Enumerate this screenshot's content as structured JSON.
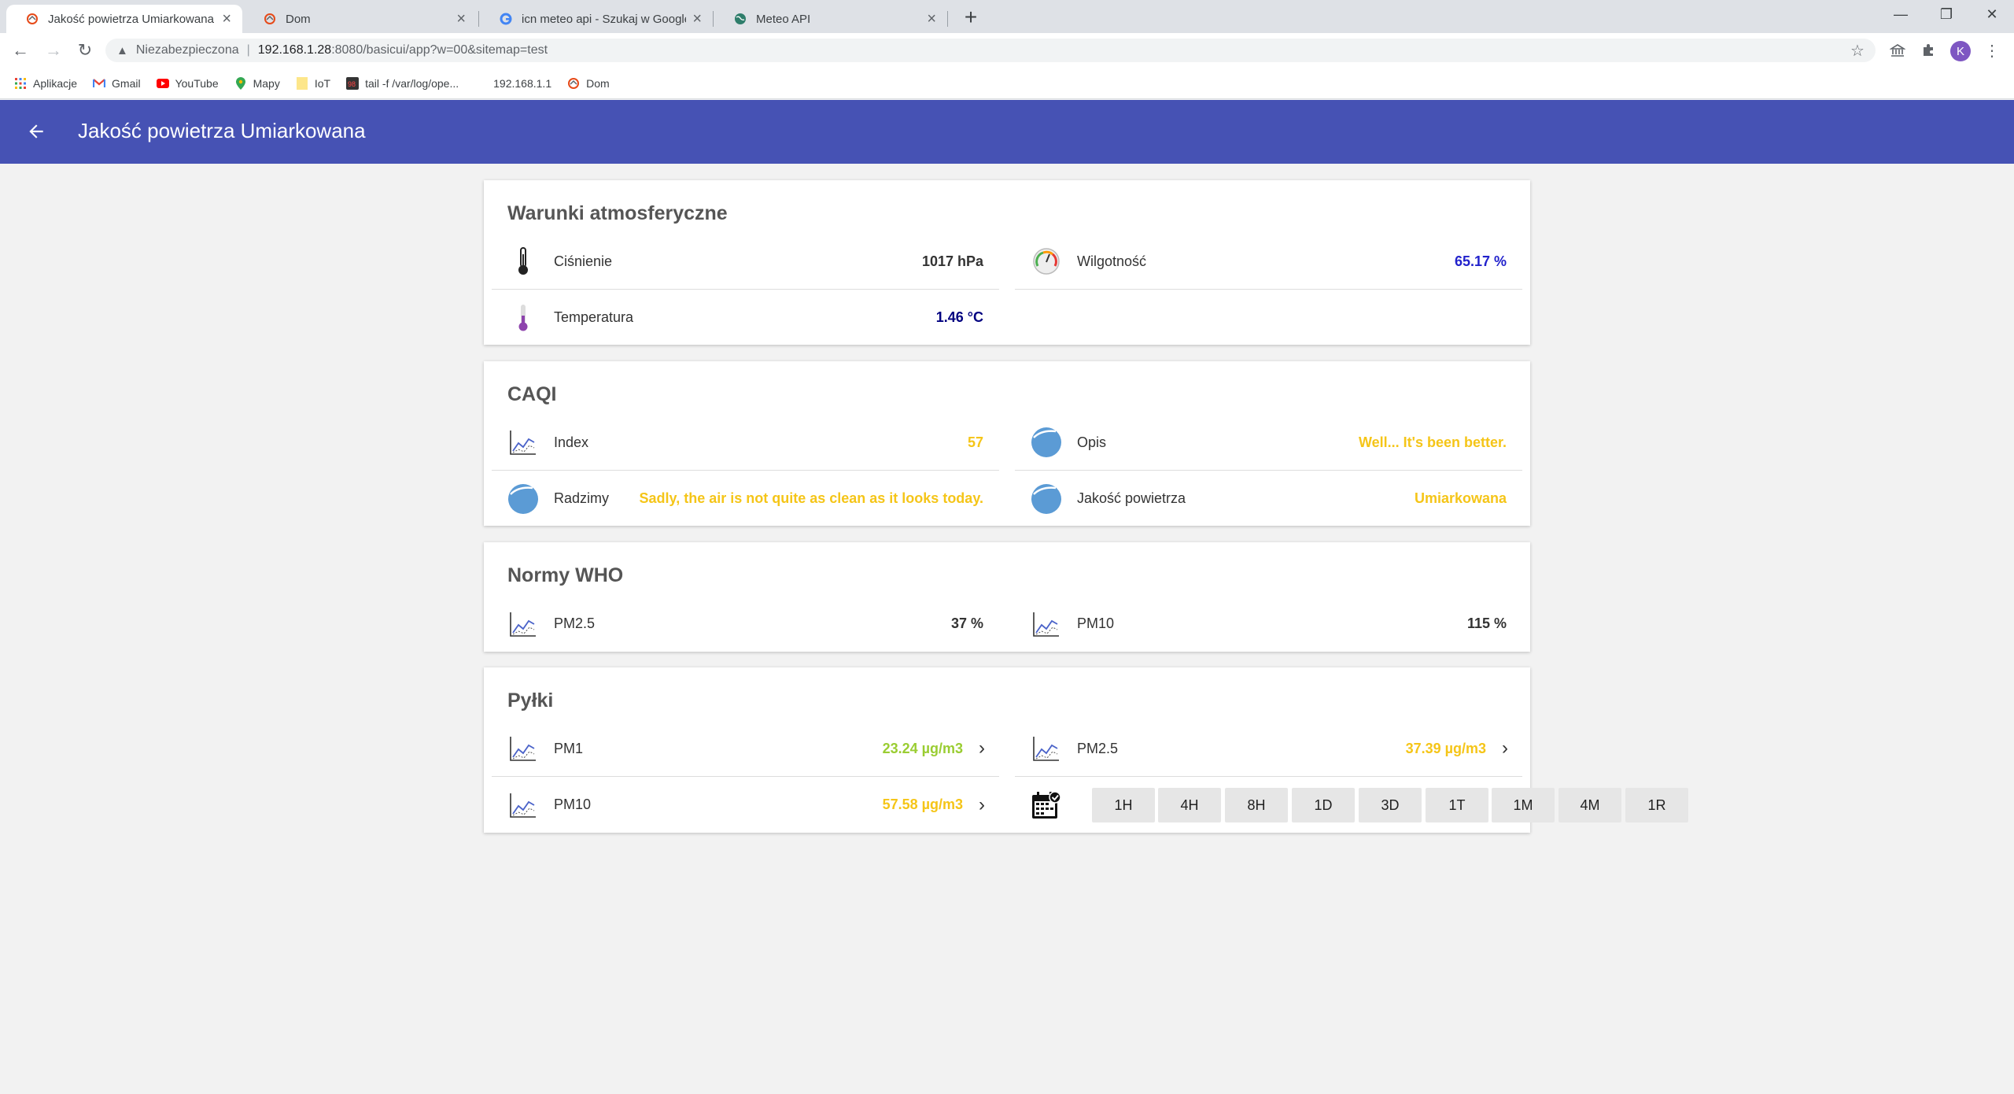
{
  "browser": {
    "tabs": [
      {
        "title": "Jakość powietrza Umiarkowana",
        "active": true
      },
      {
        "title": "Dom",
        "active": false
      },
      {
        "title": "icn meteo api - Szukaj w Google",
        "active": false
      },
      {
        "title": "Meteo API",
        "active": false
      }
    ],
    "address": {
      "security_label": "Niezabezpieczona",
      "host": "192.168.1.28",
      "path": ":8080/basicui/app?w=00&sitemap=test"
    },
    "profile_initial": "K",
    "bookmarks": [
      {
        "label": "Aplikacje",
        "icon": "apps-grid-icon"
      },
      {
        "label": "Gmail",
        "icon": "gmail-icon"
      },
      {
        "label": "YouTube",
        "icon": "youtube-icon"
      },
      {
        "label": "Mapy",
        "icon": "maps-pin-icon"
      },
      {
        "label": "IoT",
        "icon": "folder-icon"
      },
      {
        "label": "tail -f /var/log/ope...",
        "icon": "terminal-icon"
      },
      {
        "label": "192.168.1.1",
        "icon": "blank-page-icon"
      },
      {
        "label": "Dom",
        "icon": "openhab-icon"
      }
    ]
  },
  "header": {
    "title": "Jakość powietrza Umiarkowana"
  },
  "sections": {
    "atmosphere": {
      "title": "Warunki atmosferyczne",
      "pressure": {
        "label": "Ciśnienie",
        "value": "1017 hPa"
      },
      "humidity": {
        "label": "Wilgotność",
        "value": "65.17 %"
      },
      "temperature": {
        "label": "Temperatura",
        "value": "1.46 °C"
      }
    },
    "caqi": {
      "title": "CAQI",
      "index": {
        "label": "Index",
        "value": "57"
      },
      "description": {
        "label": "Opis",
        "value": "Well... It's been better."
      },
      "advice": {
        "label": "Radzimy",
        "value": "Sadly, the air is not quite as clean as it looks today."
      },
      "quality": {
        "label": "Jakość powietrza",
        "value": "Umiarkowana"
      }
    },
    "who": {
      "title": "Normy WHO",
      "pm25": {
        "label": "PM2.5",
        "value": "37 %"
      },
      "pm10": {
        "label": "PM10",
        "value": "115 %"
      }
    },
    "pollen": {
      "title": "Pyłki",
      "pm1": {
        "label": "PM1",
        "value": "23.24 µg/m3"
      },
      "pm25": {
        "label": "PM2.5",
        "value": "37.39 µg/m3"
      },
      "pm10": {
        "label": "PM10",
        "value": "57.58 µg/m3"
      },
      "periods": [
        "1H",
        "4H",
        "8H",
        "1D",
        "3D",
        "1T",
        "1M",
        "4M",
        "1R"
      ]
    }
  },
  "colors": {
    "header_bg": "#4652b4",
    "value_yellow": "#f5c518",
    "value_lime": "#9acd32",
    "value_navy": "#000080",
    "value_blue": "#2222cc"
  }
}
